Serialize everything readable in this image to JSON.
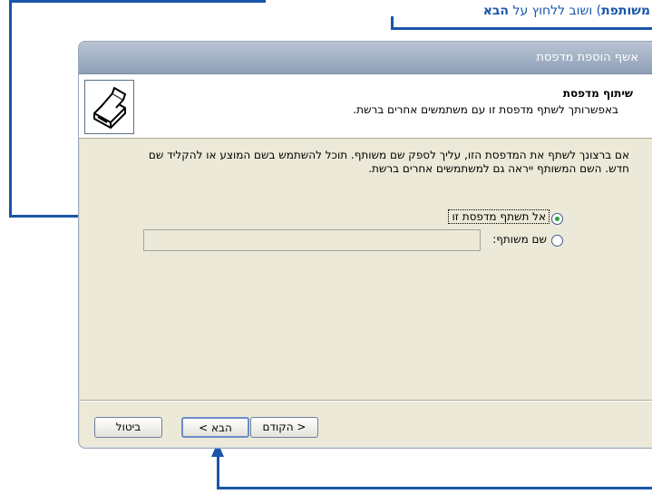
{
  "annotation": {
    "text_part1": "משותפת",
    "text_part2": ") ושוב ללחוץ על ",
    "text_part3": "הבא"
  },
  "window": {
    "title": "אשף הוספת מדפסת",
    "header_title": "שיתוף מדפסת",
    "header_subtitle": "באפשרותך לשתף מדפסת זו עם משתמשים אחרים ברשת.",
    "description": "אם ברצונך לשתף את המדפסת הזו, עליך לספק שם משותף. תוכל להשתמש בשם המוצע או להקליד שם חדש. השם המשותף ייראה גם למשתמשים אחרים ברשת.",
    "option_no_share": "אל תשתף מדפסת זו",
    "option_share_name": "שם משותף:",
    "share_name_value": "",
    "back_button": "< הקודם",
    "next_button": "הבא >",
    "cancel_button": "ביטול",
    "selected_option": "no_share"
  },
  "colors": {
    "annotation": "#1a56a8",
    "title_bar": "#8e9fb6",
    "dialog_bg": "#ece9d8"
  },
  "icons": {
    "header": "printer-icon"
  }
}
